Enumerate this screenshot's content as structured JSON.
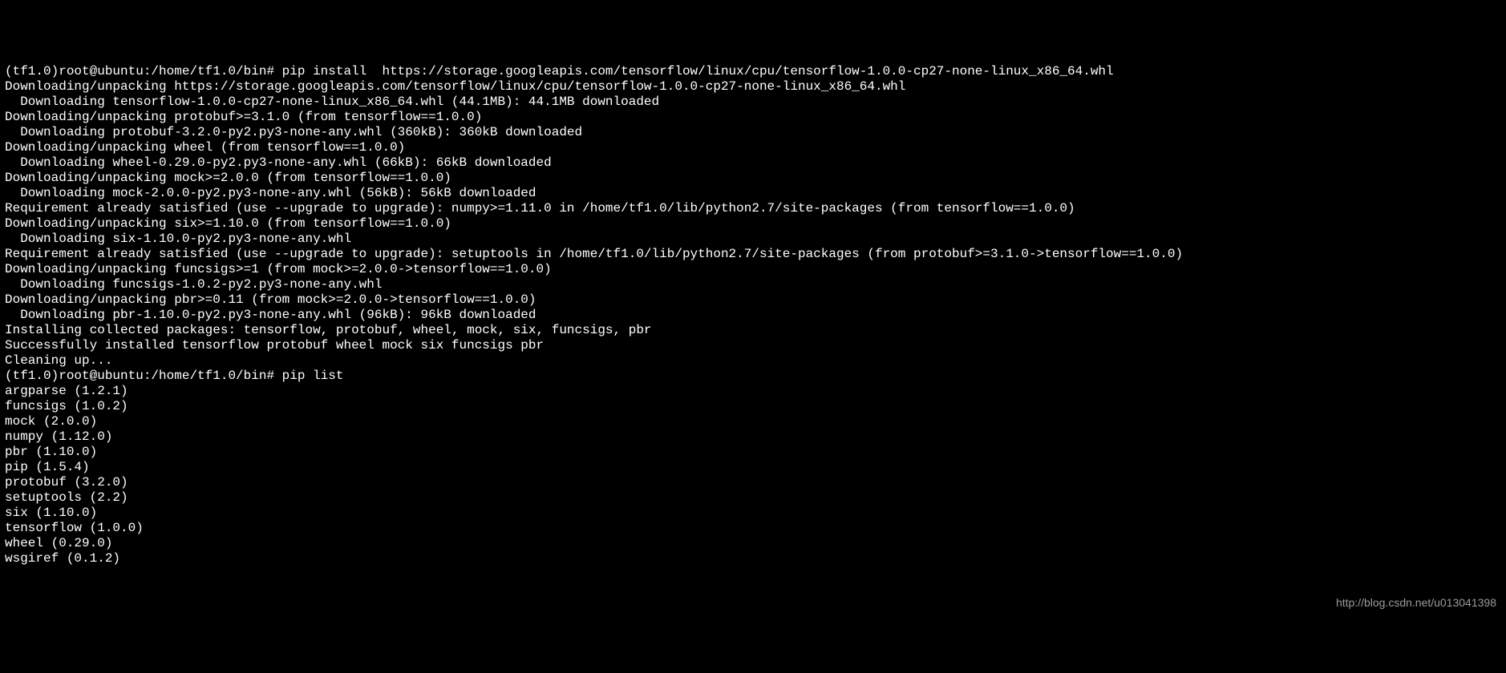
{
  "terminal": {
    "lines": [
      "(tf1.0)root@ubuntu:/home/tf1.0/bin# pip install  https://storage.googleapis.com/tensorflow/linux/cpu/tensorflow-1.0.0-cp27-none-linux_x86_64.whl",
      "Downloading/unpacking https://storage.googleapis.com/tensorflow/linux/cpu/tensorflow-1.0.0-cp27-none-linux_x86_64.whl",
      "  Downloading tensorflow-1.0.0-cp27-none-linux_x86_64.whl (44.1MB): 44.1MB downloaded",
      "Downloading/unpacking protobuf>=3.1.0 (from tensorflow==1.0.0)",
      "  Downloading protobuf-3.2.0-py2.py3-none-any.whl (360kB): 360kB downloaded",
      "Downloading/unpacking wheel (from tensorflow==1.0.0)",
      "  Downloading wheel-0.29.0-py2.py3-none-any.whl (66kB): 66kB downloaded",
      "Downloading/unpacking mock>=2.0.0 (from tensorflow==1.0.0)",
      "  Downloading mock-2.0.0-py2.py3-none-any.whl (56kB): 56kB downloaded",
      "Requirement already satisfied (use --upgrade to upgrade): numpy>=1.11.0 in /home/tf1.0/lib/python2.7/site-packages (from tensorflow==1.0.0)",
      "Downloading/unpacking six>=1.10.0 (from tensorflow==1.0.0)",
      "  Downloading six-1.10.0-py2.py3-none-any.whl",
      "Requirement already satisfied (use --upgrade to upgrade): setuptools in /home/tf1.0/lib/python2.7/site-packages (from protobuf>=3.1.0->tensorflow==1.0.0)",
      "Downloading/unpacking funcsigs>=1 (from mock>=2.0.0->tensorflow==1.0.0)",
      "  Downloading funcsigs-1.0.2-py2.py3-none-any.whl",
      "Downloading/unpacking pbr>=0.11 (from mock>=2.0.0->tensorflow==1.0.0)",
      "  Downloading pbr-1.10.0-py2.py3-none-any.whl (96kB): 96kB downloaded",
      "Installing collected packages: tensorflow, protobuf, wheel, mock, six, funcsigs, pbr",
      "Successfully installed tensorflow protobuf wheel mock six funcsigs pbr",
      "Cleaning up...",
      "(tf1.0)root@ubuntu:/home/tf1.0/bin# pip list",
      "argparse (1.2.1)",
      "funcsigs (1.0.2)",
      "mock (2.0.0)",
      "numpy (1.12.0)",
      "pbr (1.10.0)",
      "pip (1.5.4)",
      "protobuf (3.2.0)",
      "setuptools (2.2)",
      "six (1.10.0)",
      "tensorflow (1.0.0)",
      "wheel (0.29.0)",
      "wsgiref (0.1.2)"
    ]
  },
  "watermark": "http://blog.csdn.net/u013041398"
}
